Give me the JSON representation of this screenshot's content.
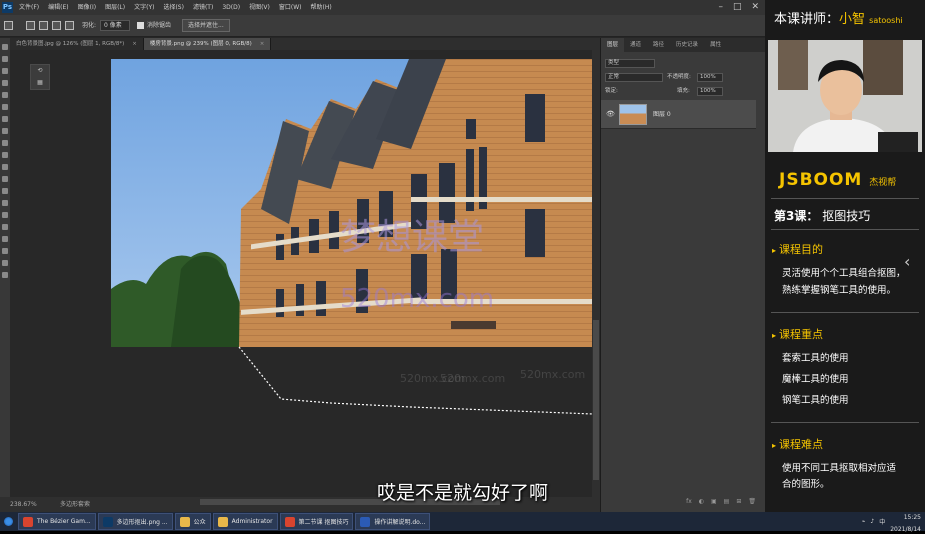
{
  "photoshop": {
    "menu": [
      "文件(F)",
      "编辑(E)",
      "图像(I)",
      "图层(L)",
      "文字(Y)",
      "选择(S)",
      "滤镜(T)",
      "3D(D)",
      "视图(V)",
      "窗口(W)",
      "帮助(H)"
    ],
    "options_bar": {
      "feather_label": "羽化:",
      "feather_value": "0 像素",
      "antialias_label": "消除锯齿",
      "select_mask_button": "选择并遮住..."
    },
    "tabs": [
      {
        "label": "白色背景图.jpg @ 126% (图层 1, RGB/8*)",
        "active": false
      },
      {
        "label": "楼房背景.png @ 239% (图层 0, RGB/8)",
        "active": true
      }
    ],
    "status": {
      "zoom": "238.67%",
      "tool_hint": "多边形套索"
    },
    "panel": {
      "tabs": [
        "图层",
        "通道",
        "路径",
        "历史记录",
        "属性"
      ],
      "kind_label": "类型",
      "blend_mode": "正常",
      "opacity_label": "不透明度:",
      "opacity_value": "100%",
      "lock_label": "锁定:",
      "fill_label": "填充:",
      "fill_value": "100%",
      "layer_name": "图层 0",
      "footer_icons": [
        "fx",
        "◐",
        "▣",
        "▤",
        "⊞",
        "🗑"
      ]
    }
  },
  "watermark": {
    "line1": "梦想课堂",
    "line2": "520mx.com",
    "small": "520mx.com"
  },
  "subtitle": "哎是不是就勾好了啊",
  "sidebar": {
    "teacher_label": "本课讲师：",
    "teacher_name": "小智",
    "teacher_en": "satooshi",
    "brand": "JSBOOM",
    "brand_cn": "杰视帮",
    "lesson_no": "第3课：",
    "lesson_title": "抠图技巧",
    "sections": [
      {
        "title": "课程目的",
        "lines": [
          "灵活使用个个工具组合抠图，",
          "熟练掌握钢笔工具的使用。"
        ]
      },
      {
        "title": "课程重点",
        "lines": [
          "套索工具的使用",
          "魔棒工具的使用",
          "钢笔工具的使用"
        ]
      },
      {
        "title": "课程难点",
        "lines": [
          "使用不同工具抠取相对应适",
          "合的图形。"
        ]
      }
    ]
  },
  "taskbar": {
    "items": [
      {
        "label": "The Bézier Gam...",
        "color": "#d9442f"
      },
      {
        "label": "多边形抠出.png ...",
        "color": "#0d3a66"
      },
      {
        "label": "公众",
        "color": "#e8b84a"
      },
      {
        "label": "Administrator",
        "color": "#e8b84a"
      },
      {
        "label": "第二节课 抠图技巧",
        "color": "#d9442f"
      },
      {
        "label": "操作讲解说明.do...",
        "color": "#2b5bb5"
      }
    ],
    "time": "15:25",
    "date": "2021/8/14"
  }
}
